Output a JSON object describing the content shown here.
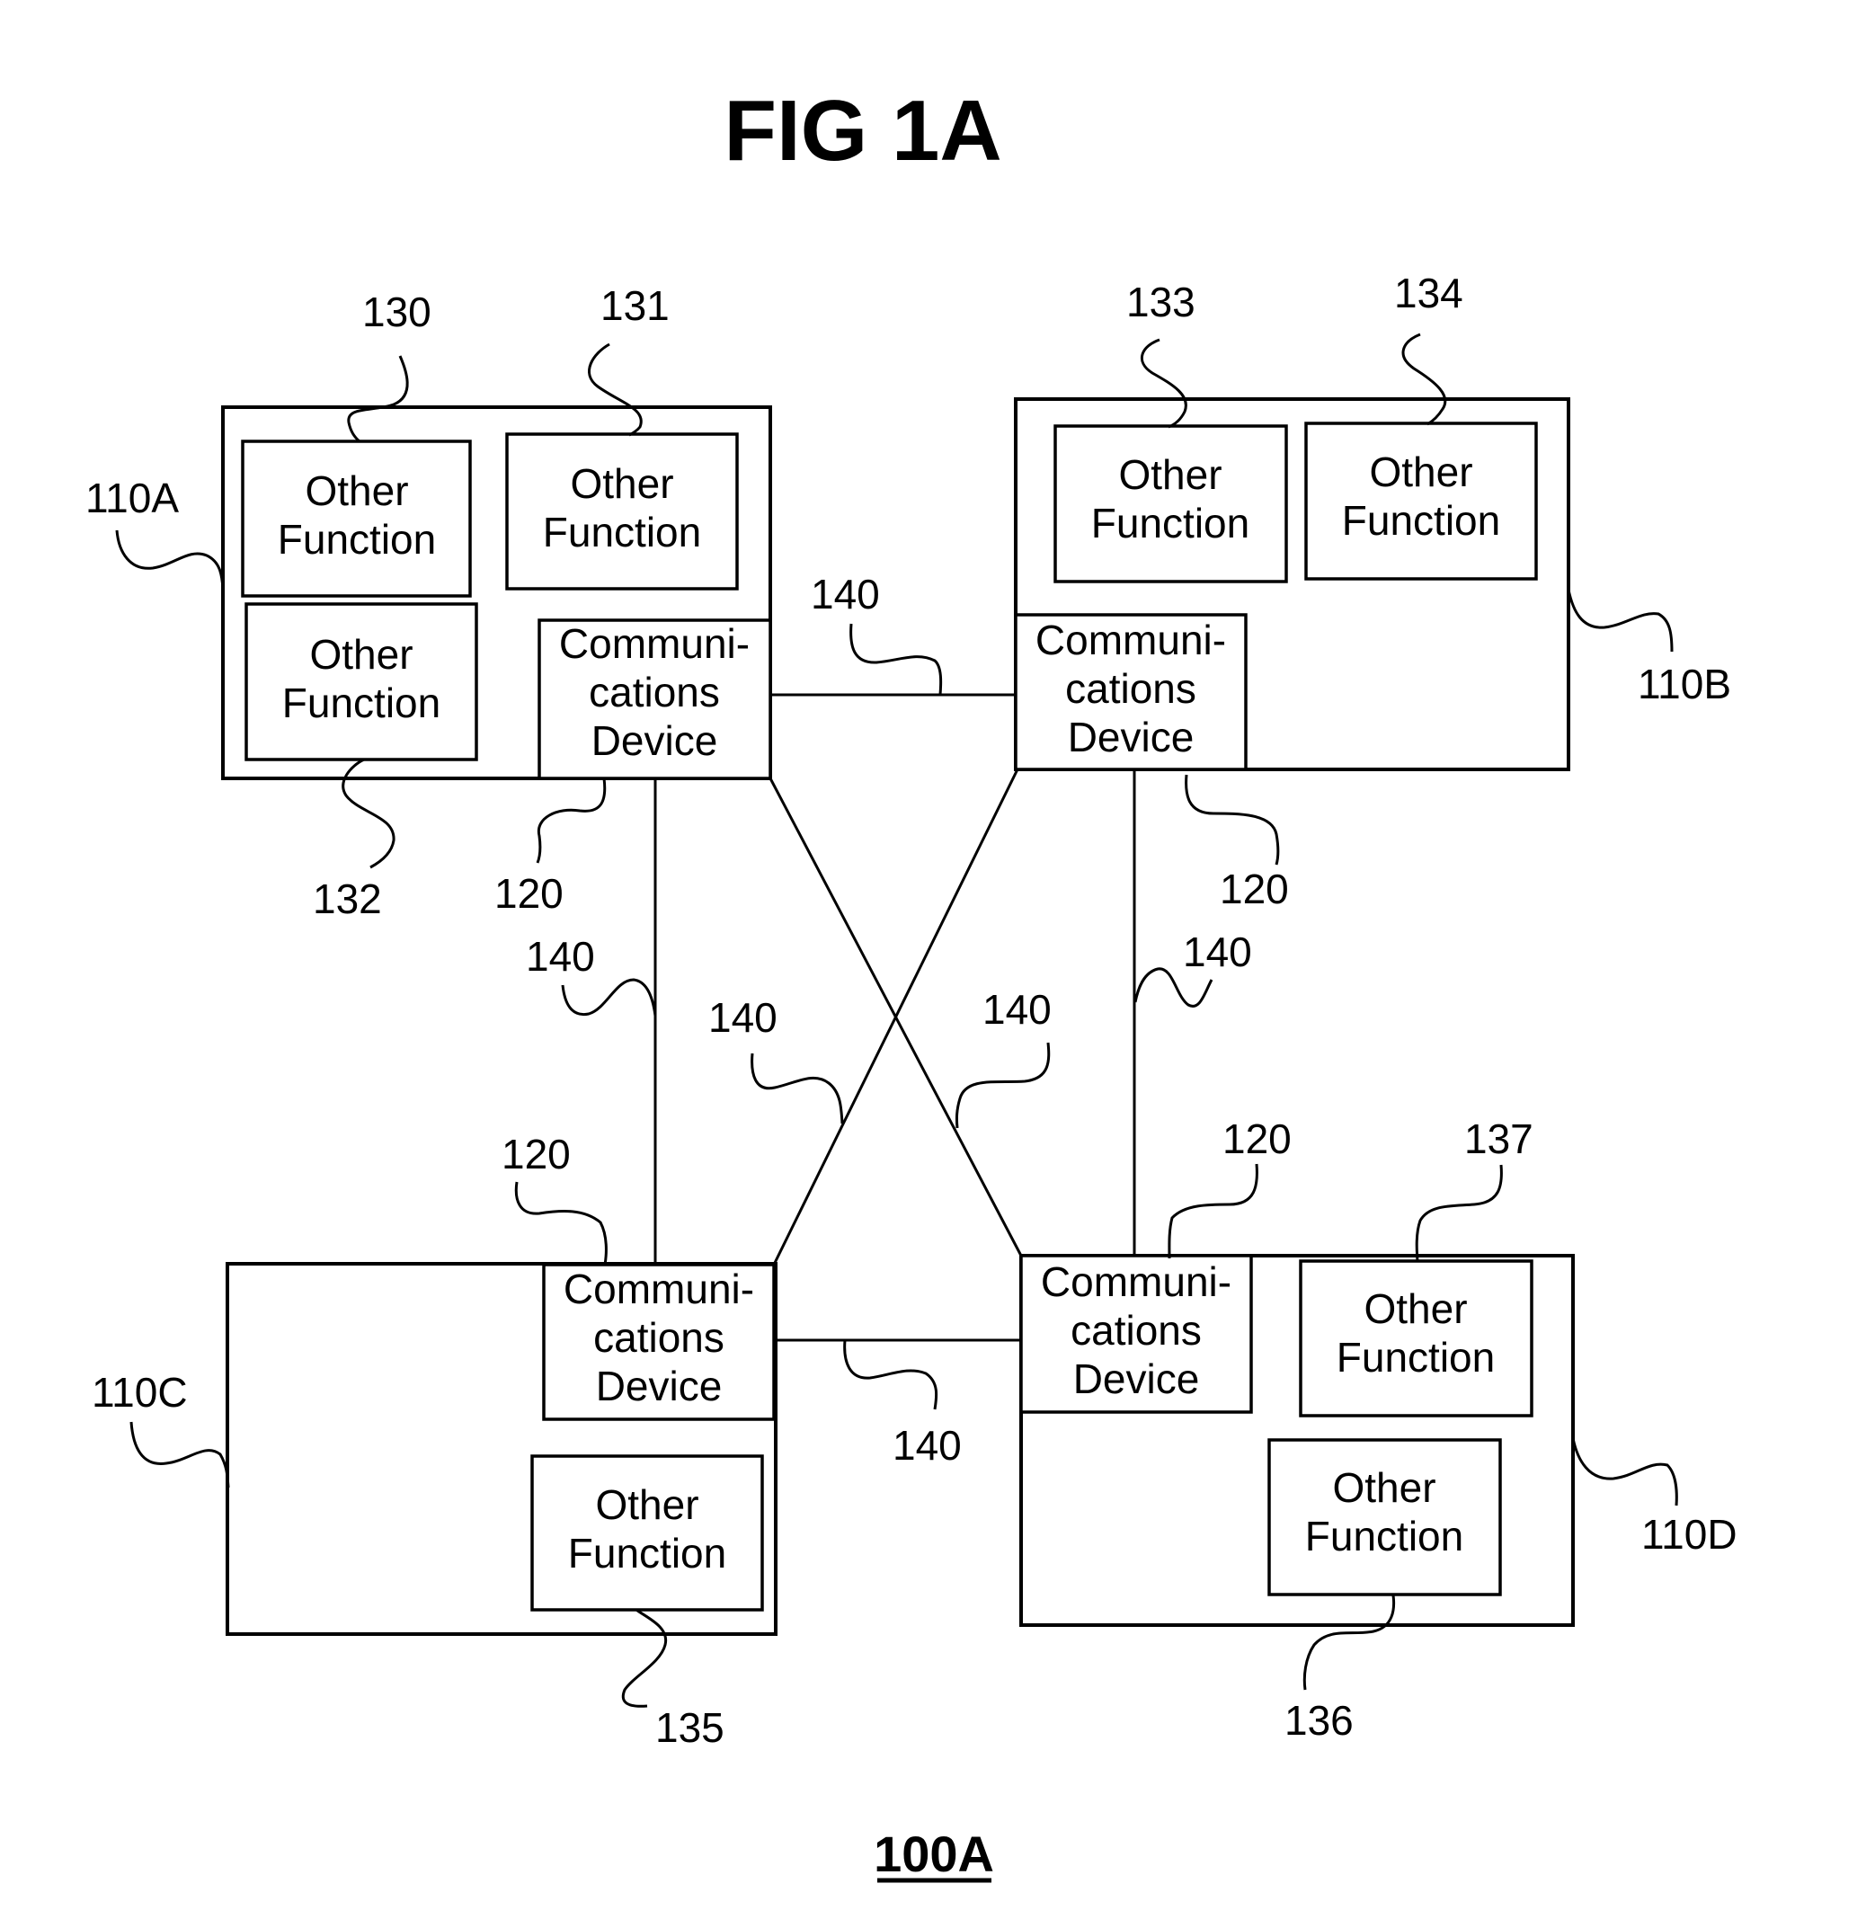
{
  "figure": {
    "title": "FIG 1A",
    "figure_id": "100A"
  },
  "labels": {
    "other_function_line1": "Other",
    "other_function_line2": "Function",
    "comm_line1": "Communi-",
    "comm_line2": "cations",
    "comm_line3": "Device"
  },
  "nodes": [
    {
      "id": "110A",
      "ref": "110A",
      "comm_ref": "120",
      "functions": [
        "130",
        "131",
        "132"
      ]
    },
    {
      "id": "110B",
      "ref": "110B",
      "comm_ref": "120",
      "functions": [
        "133",
        "134"
      ]
    },
    {
      "id": "110C",
      "ref": "110C",
      "comm_ref": "120",
      "functions": [
        "135"
      ]
    },
    {
      "id": "110D",
      "ref": "110D",
      "comm_ref": "120",
      "functions": [
        "136",
        "137"
      ]
    }
  ],
  "refs": {
    "r130": "130",
    "r131": "131",
    "r132": "132",
    "r133": "133",
    "r134": "134",
    "r135": "135",
    "r136": "136",
    "r137": "137",
    "r120a": "120",
    "r120b": "120",
    "r120c": "120",
    "r120d": "120",
    "r140_ab": "140",
    "r140_ac": "140",
    "r140_bd": "140",
    "r140_cd": "140",
    "r140_bc": "140",
    "r140_ad": "140",
    "r110a": "110A",
    "r110b": "110B",
    "r110c": "110C",
    "r110d": "110D"
  },
  "connections": [
    {
      "from": "110A",
      "to": "110B",
      "ref": "140"
    },
    {
      "from": "110A",
      "to": "110C",
      "ref": "140"
    },
    {
      "from": "110A",
      "to": "110D",
      "ref": "140"
    },
    {
      "from": "110B",
      "to": "110C",
      "ref": "140"
    },
    {
      "from": "110B",
      "to": "110D",
      "ref": "140"
    },
    {
      "from": "110C",
      "to": "110D",
      "ref": "140"
    }
  ]
}
